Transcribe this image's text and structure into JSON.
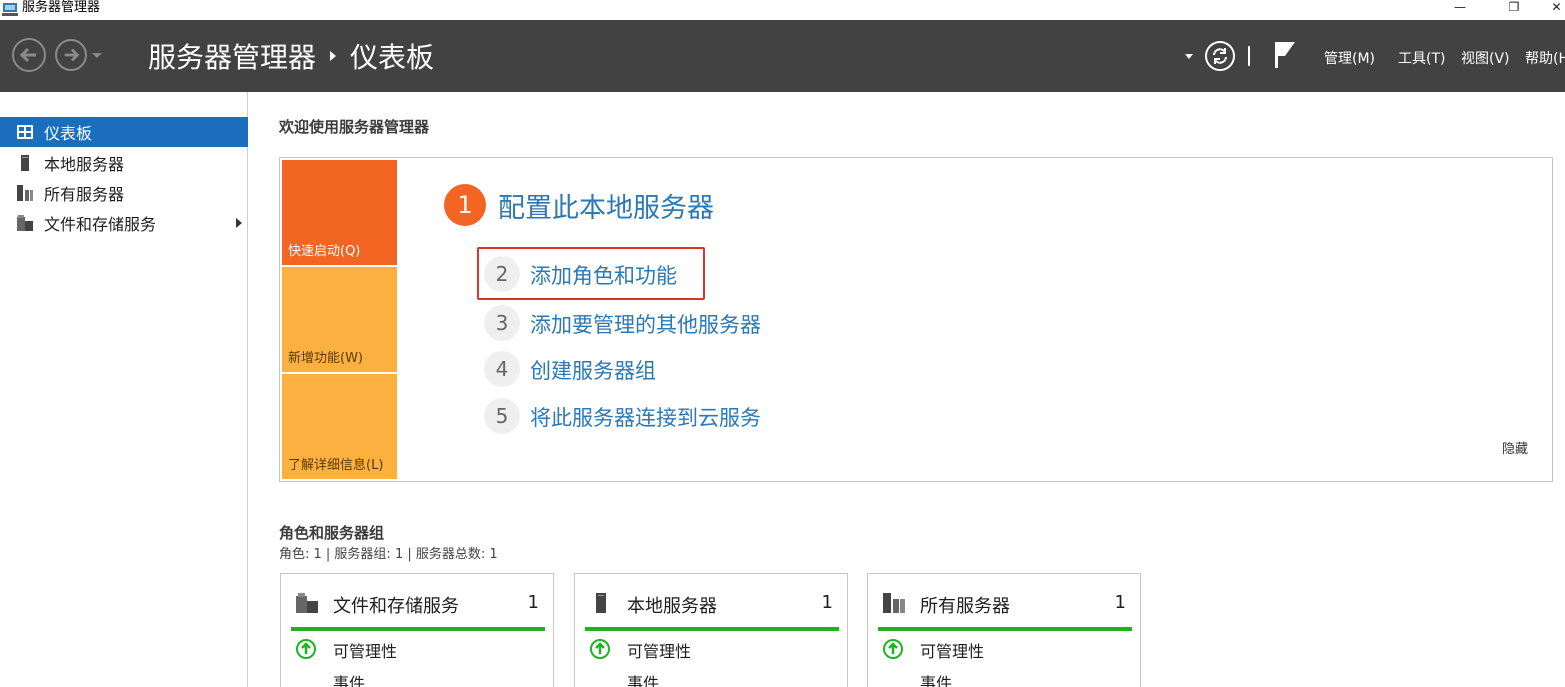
{
  "window": {
    "title": "服务器管理器",
    "minimize_glyph": "—",
    "restore_glyph": "❐",
    "close_glyph": "✕"
  },
  "header": {
    "app_name": "服务器管理器",
    "page": "仪表板",
    "menus": [
      "管理(M)",
      "工具(T)",
      "视图(V)",
      "帮助(H"
    ]
  },
  "sidebar": {
    "items": [
      {
        "label": "仪表板",
        "icon": "dashboard-icon",
        "active": true
      },
      {
        "label": "本地服务器",
        "icon": "server-icon",
        "active": false
      },
      {
        "label": "所有服务器",
        "icon": "servers-icon",
        "active": false
      },
      {
        "label": "文件和存储服务",
        "icon": "file-storage-icon",
        "active": false,
        "expandable": true
      }
    ]
  },
  "welcome": {
    "title": "欢迎使用服务器管理器",
    "tiles": [
      "快速启动(Q)",
      "新增功能(W)",
      "了解详细信息(L)"
    ],
    "step1": {
      "num": "1",
      "label": "配置此本地服务器"
    },
    "steps": [
      {
        "num": "2",
        "label": "添加角色和功能"
      },
      {
        "num": "3",
        "label": "添加要管理的其他服务器"
      },
      {
        "num": "4",
        "label": "创建服务器组"
      },
      {
        "num": "5",
        "label": "将此服务器连接到云服务"
      }
    ],
    "hide": "隐藏"
  },
  "roles": {
    "title": "角色和服务器组",
    "summary": "角色: 1 | 服务器组: 1 | 服务器总数: 1",
    "cards": [
      {
        "name": "文件和存储服务",
        "count": "1",
        "row1": "可管理性",
        "row2": "事件"
      },
      {
        "name": "本地服务器",
        "count": "1",
        "row1": "可管理性",
        "row2": "事件"
      },
      {
        "name": "所有服务器",
        "count": "1",
        "row1": "可管理性",
        "row2": "事件"
      }
    ]
  },
  "colors": {
    "header_bg": "#424242",
    "accent_blue": "#1a6ebd",
    "link_blue": "#2b79b6",
    "tile_orange": "#f26522",
    "tile_amber": "#fbb040",
    "status_green": "#1db51d",
    "highlight_red": "#d9352b"
  }
}
